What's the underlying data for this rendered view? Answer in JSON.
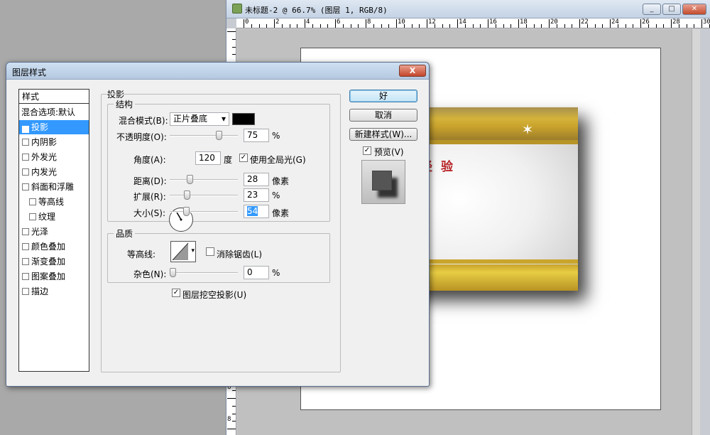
{
  "document": {
    "title": "未标题-2 @ 66.7% (图层 1, RGB/8)",
    "window_buttons": [
      "_",
      "□",
      "✕"
    ],
    "hruler_labels": [
      "0",
      "2",
      "4",
      "6",
      "8",
      "10",
      "12",
      "14",
      "16",
      "18",
      "20",
      "22",
      "24",
      "26",
      "28",
      "30"
    ],
    "vruler_labels": [
      "6",
      "8"
    ],
    "card_text": "百度经验"
  },
  "dialog": {
    "title": "图层样式",
    "close_label": "X",
    "style_header": "样式",
    "blend_default": "混合选项:默认",
    "styles": [
      {
        "label": "投影",
        "checked": true,
        "selected": true,
        "indent": false
      },
      {
        "label": "内阴影",
        "checked": false,
        "selected": false,
        "indent": false
      },
      {
        "label": "外发光",
        "checked": false,
        "selected": false,
        "indent": false
      },
      {
        "label": "内发光",
        "checked": false,
        "selected": false,
        "indent": false
      },
      {
        "label": "斜面和浮雕",
        "checked": false,
        "selected": false,
        "indent": false
      },
      {
        "label": "等高线",
        "checked": false,
        "selected": false,
        "indent": true
      },
      {
        "label": "纹理",
        "checked": false,
        "selected": false,
        "indent": true
      },
      {
        "label": "光泽",
        "checked": false,
        "selected": false,
        "indent": false
      },
      {
        "label": "颜色叠加",
        "checked": false,
        "selected": false,
        "indent": false
      },
      {
        "label": "渐变叠加",
        "checked": false,
        "selected": false,
        "indent": false
      },
      {
        "label": "图案叠加",
        "checked": false,
        "selected": false,
        "indent": false
      },
      {
        "label": "描边",
        "checked": false,
        "selected": false,
        "indent": false
      }
    ],
    "section_title": "投影",
    "structure": {
      "title": "结构",
      "blend_mode_label": "混合模式(B):",
      "blend_mode_value": "正片叠底",
      "shadow_color": "#000000",
      "opacity_label": "不透明度(O):",
      "opacity_value": "75",
      "opacity_unit": "%",
      "opacity_level": 0.75,
      "angle_label": "角度(A):",
      "angle_value": "120",
      "angle_unit": "度",
      "global_light_label": "使用全局光(G)",
      "global_light_checked": true,
      "distance_label": "距离(D):",
      "distance_value": "28",
      "distance_unit": "像素",
      "distance_level": 0.28,
      "spread_label": "扩展(R):",
      "spread_value": "23",
      "spread_unit": "%",
      "spread_level": 0.23,
      "size_label": "大小(S):",
      "size_value": "54",
      "size_unit": "像素",
      "size_level": 0.22
    },
    "quality": {
      "title": "品质",
      "contour_label": "等高线:",
      "antialias_label": "消除锯齿(L)",
      "antialias_checked": false,
      "noise_label": "杂色(N):",
      "noise_value": "0",
      "noise_unit": "%",
      "noise_level": 0
    },
    "knockout_label": "图层挖空投影(U)",
    "knockout_checked": true,
    "buttons": {
      "ok": "好",
      "cancel": "取消",
      "new_style": "新建样式(W)..."
    },
    "preview_label": "预览(V)",
    "preview_checked": true
  }
}
